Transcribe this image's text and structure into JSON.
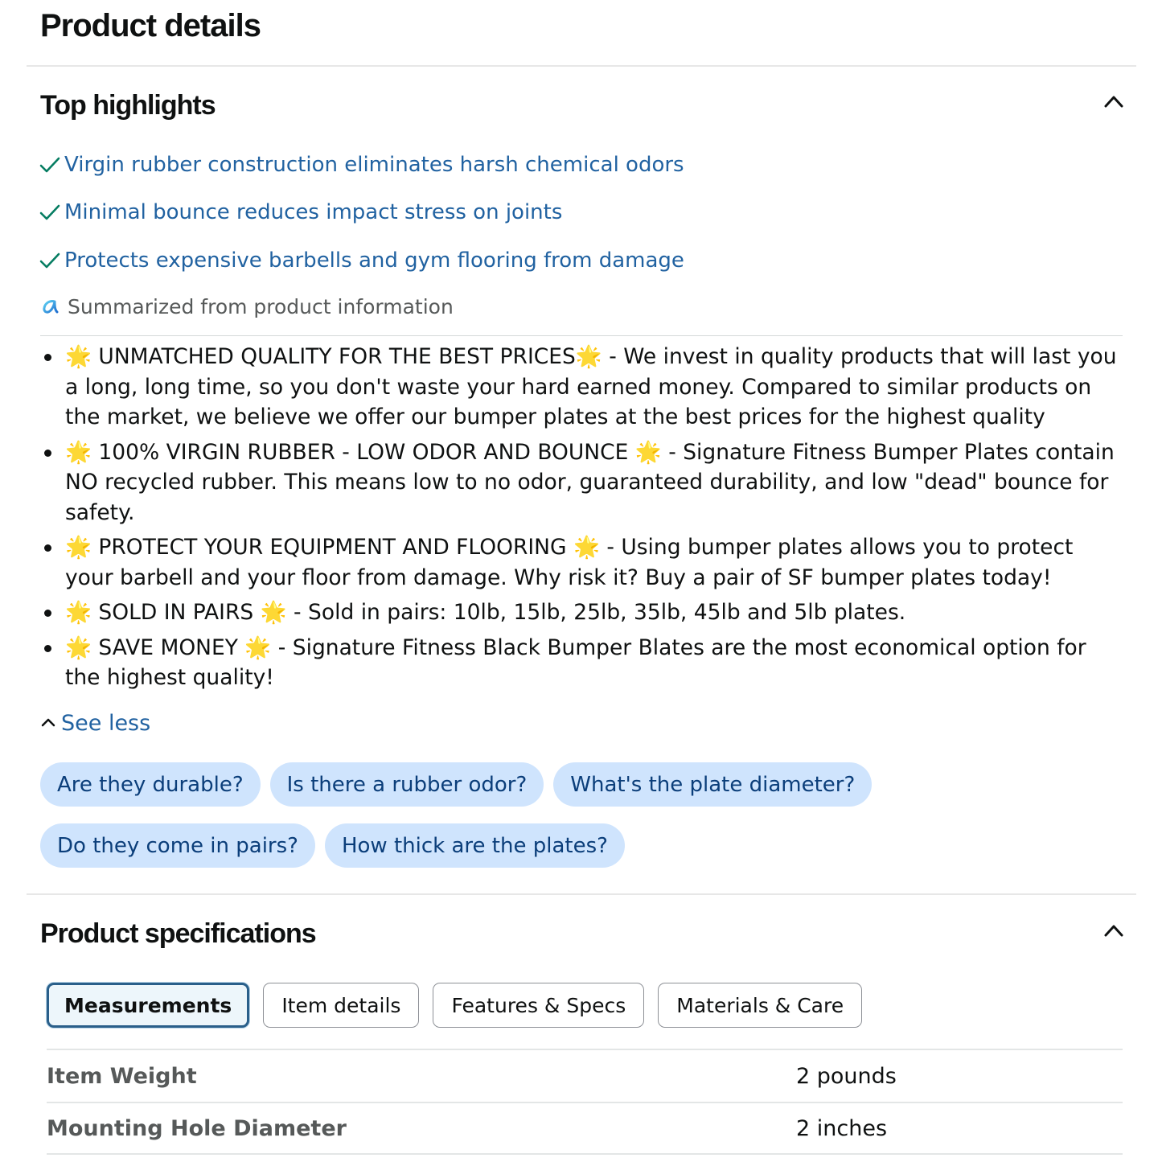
{
  "page": {
    "title": "Product details"
  },
  "top_highlights": {
    "title": "Top highlights",
    "items": [
      "Virgin rubber construction eliminates harsh chemical odors",
      "Minimal bounce reduces impact stress on joints",
      "Protects expensive barbells and gym flooring from damage"
    ],
    "summary_note": "Summarized from product information",
    "bullets": [
      "🌟 UNMATCHED QUALITY FOR THE BEST PRICES🌟 - We invest in quality products that will last you a long, long time, so you don't waste your hard earned money. Compared to similar products on the market, we believe we offer our bumper plates at the best prices for the highest quality",
      "🌟 100% VIRGIN RUBBER - LOW ODOR AND BOUNCE 🌟 - Signature Fitness Bumper Plates contain NO recycled rubber. This means low to no odor, guaranteed durability, and low \"dead\" bounce for safety.",
      "🌟 PROTECT YOUR EQUIPMENT AND FLOORING 🌟 - Using bumper plates allows you to protect your barbell and your floor from damage. Why risk it? Buy a pair of SF bumper plates today!",
      "🌟 SOLD IN PAIRS 🌟 - Sold in pairs: 10lb, 15lb, 25lb, 35lb, 45lb and 5lb plates.",
      "🌟 SAVE MONEY 🌟 - Signature Fitness Black Bumper Blates are the most economical option for the highest quality!"
    ],
    "see_less_label": "See less",
    "questions_row1": [
      "Are they durable?",
      "Is there a rubber odor?",
      "What's the plate diameter?"
    ],
    "questions_row2": [
      "Do they come in pairs?",
      "How thick are the plates?"
    ]
  },
  "specifications": {
    "title": "Product specifications",
    "tabs": [
      "Measurements",
      "Item details",
      "Features & Specs",
      "Materials & Care"
    ],
    "active_tab": "Measurements",
    "rows": [
      {
        "label": "Item Weight",
        "value": "2 pounds"
      },
      {
        "label": "Mounting Hole Diameter",
        "value": "2 inches"
      }
    ]
  },
  "colors": {
    "link": "#2162a1",
    "check": "#067d62",
    "chip_bg": "#cfe4fd",
    "chip_text": "#0b3e7a",
    "active_tab_border": "#2a5f8a"
  },
  "icons": {
    "collapse": "chevron-up-icon",
    "highlight": "checkmark-icon",
    "summary": "ai-sparkle-icon"
  }
}
